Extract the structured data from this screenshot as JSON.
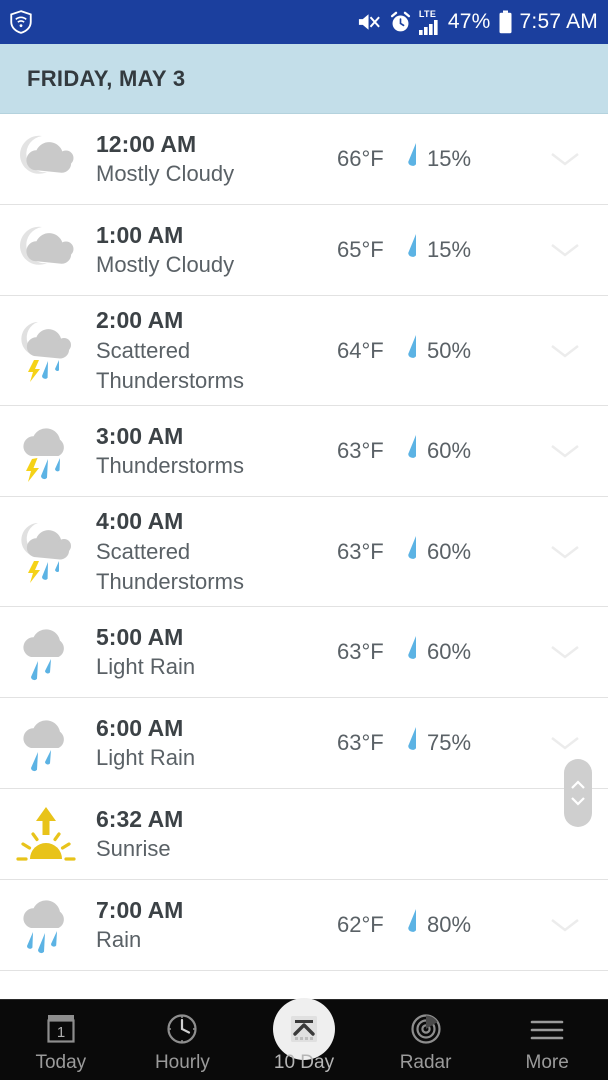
{
  "status_bar": {
    "app_icon": "shield-wifi-icon",
    "icons": [
      "mute-vibrate-icon",
      "alarm-clock-icon",
      "lte-signal-icon"
    ],
    "network_label": "LTE",
    "battery_percent": "47%",
    "battery_icon": "battery-icon",
    "time": "7:57 AM",
    "background_color": "#1b3f9e"
  },
  "day_header": {
    "title": "FRIDAY, MAY 3",
    "background_color": "#c3dee9"
  },
  "hours": [
    {
      "time": "12:00 AM",
      "condition": "Mostly Cloudy",
      "temperature": "66°F",
      "precipitation": "15%",
      "icon": "moon-behind-cloud-icon",
      "expand_icon": "chevron-down-icon",
      "lines": 1
    },
    {
      "time": "1:00 AM",
      "condition": "Mostly Cloudy",
      "temperature": "65°F",
      "precipitation": "15%",
      "icon": "moon-behind-cloud-icon",
      "expand_icon": "chevron-down-icon",
      "lines": 1
    },
    {
      "time": "2:00 AM",
      "condition": "Scattered Thunderstorms",
      "temperature": "64°F",
      "precipitation": "50%",
      "icon": "moon-cloud-thunderstorm-icon",
      "expand_icon": "chevron-down-icon",
      "lines": 2
    },
    {
      "time": "3:00 AM",
      "condition": "Thunderstorms",
      "temperature": "63°F",
      "precipitation": "60%",
      "icon": "cloud-thunderstorm-icon",
      "expand_icon": "chevron-down-icon",
      "lines": 1
    },
    {
      "time": "4:00 AM",
      "condition": "Scattered Thunderstorms",
      "temperature": "63°F",
      "precipitation": "60%",
      "icon": "moon-cloud-thunderstorm-icon",
      "expand_icon": "chevron-down-icon",
      "lines": 2
    },
    {
      "time": "5:00 AM",
      "condition": "Light Rain",
      "temperature": "63°F",
      "precipitation": "60%",
      "icon": "cloud-rain-icon",
      "expand_icon": "chevron-down-icon",
      "lines": 1
    },
    {
      "time": "6:00 AM",
      "condition": "Light Rain",
      "temperature": "63°F",
      "precipitation": "75%",
      "icon": "cloud-rain-icon",
      "expand_icon": "chevron-down-icon",
      "lines": 1
    },
    {
      "time": "6:32 AM",
      "condition": "Sunrise",
      "temperature": "",
      "precipitation": "",
      "icon": "sunrise-icon",
      "expand_icon": "",
      "lines": 1
    },
    {
      "time": "7:00 AM",
      "condition": "Rain",
      "temperature": "62°F",
      "precipitation": "80%",
      "icon": "cloud-heavy-rain-icon",
      "expand_icon": "chevron-down-icon",
      "lines": 1
    }
  ],
  "scrollbar": {
    "up_icon": "chevron-up-icon",
    "down_icon": "chevron-down-icon",
    "thumb_color": "#cfcfcf"
  },
  "bottom_nav": {
    "items": [
      {
        "label": "Today",
        "icon": "calendar-today-icon",
        "selected": false
      },
      {
        "label": "Hourly",
        "icon": "clock-icon",
        "selected": false
      },
      {
        "label": "10 Day",
        "icon": "calendar-up-icon",
        "selected": true
      },
      {
        "label": "Radar",
        "icon": "radar-icon",
        "selected": false
      },
      {
        "label": "More",
        "icon": "hamburger-menu-icon",
        "selected": false
      }
    ],
    "background_color": "#0a0a0a"
  },
  "colors": {
    "precip_blue": "#5cb3e4",
    "lightning_yellow": "#f5d218",
    "cloud_gray": "#c9c9c9",
    "sun_yellow": "#e8c31a"
  }
}
